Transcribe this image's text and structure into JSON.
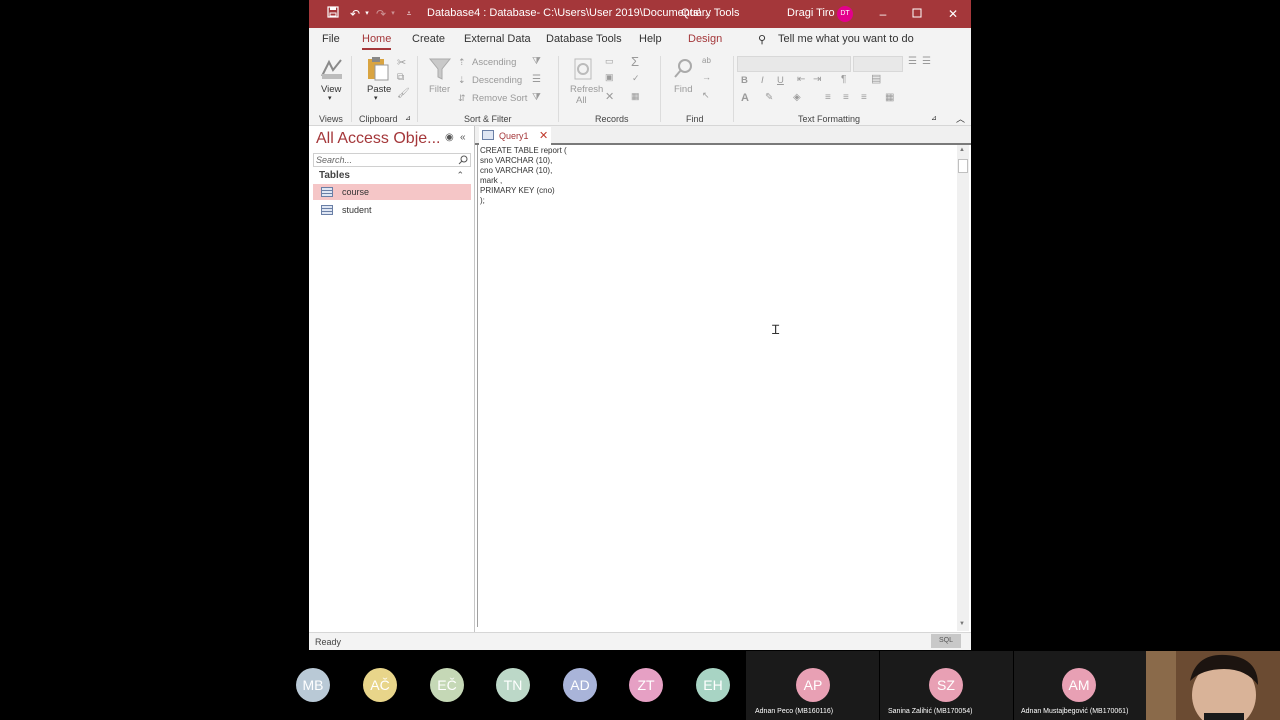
{
  "titlebar": {
    "title": "Database4 : Database- C:\\Users\\User 2019\\Documents\\...",
    "context_tab": "Query Tools",
    "user_name": "Dragi Tiro",
    "user_initials": "DT"
  },
  "menu": {
    "file": "File",
    "home": "Home",
    "create": "Create",
    "external_data": "External Data",
    "database_tools": "Database Tools",
    "help": "Help",
    "design": "Design",
    "tell_me": "Tell me what you want to do"
  },
  "ribbon": {
    "views": {
      "view": "View",
      "label": "Views"
    },
    "clipboard": {
      "paste": "Paste",
      "label": "Clipboard"
    },
    "sort_filter": {
      "filter": "Filter",
      "ascending": "Ascending",
      "descending": "Descending",
      "remove_sort": "Remove Sort",
      "label": "Sort & Filter"
    },
    "records": {
      "refresh": "Refresh",
      "all": "All",
      "label": "Records"
    },
    "find": {
      "find": "Find",
      "label": "Find"
    },
    "text_formatting": {
      "label": "Text Formatting",
      "bold": "B",
      "italic": "I",
      "underline": "U",
      "font_color": "A"
    }
  },
  "nav": {
    "title": "All Access Obje...",
    "search_placeholder": "Search...",
    "section": "Tables",
    "items": [
      {
        "label": "course",
        "selected": true
      },
      {
        "label": "student",
        "selected": false
      }
    ]
  },
  "document": {
    "tab_label": "Query1",
    "sql_lines": [
      "CREATE TABLE report (",
      "sno VARCHAR (10),",
      "cno VARCHAR (10),",
      "mark ,",
      "PRIMARY KEY (cno)",
      ");"
    ]
  },
  "status": {
    "text": "Ready",
    "view": "SQL"
  },
  "participants": [
    {
      "initials": "MB",
      "color": "#b9c9d6"
    },
    {
      "initials": "AČ",
      "color": "#e8d58a"
    },
    {
      "initials": "EČ",
      "color": "#c5d8b6"
    },
    {
      "initials": "TN",
      "color": "#bcd8c8"
    },
    {
      "initials": "AD",
      "color": "#a9b4d9"
    },
    {
      "initials": "ZT",
      "color": "#e6a0c4"
    },
    {
      "initials": "EH",
      "color": "#a8d4c4"
    },
    {
      "initials": "AP",
      "color": "#e8a0b4",
      "name": "Adnan Peco (MB160116)"
    },
    {
      "initials": "SZ",
      "color": "#e8a0b4",
      "name": "Sanina Zalihić (MB170054)"
    },
    {
      "initials": "AM",
      "color": "#e8a0b4",
      "name": "Adnan Mustajbegović (MB170061)"
    }
  ]
}
